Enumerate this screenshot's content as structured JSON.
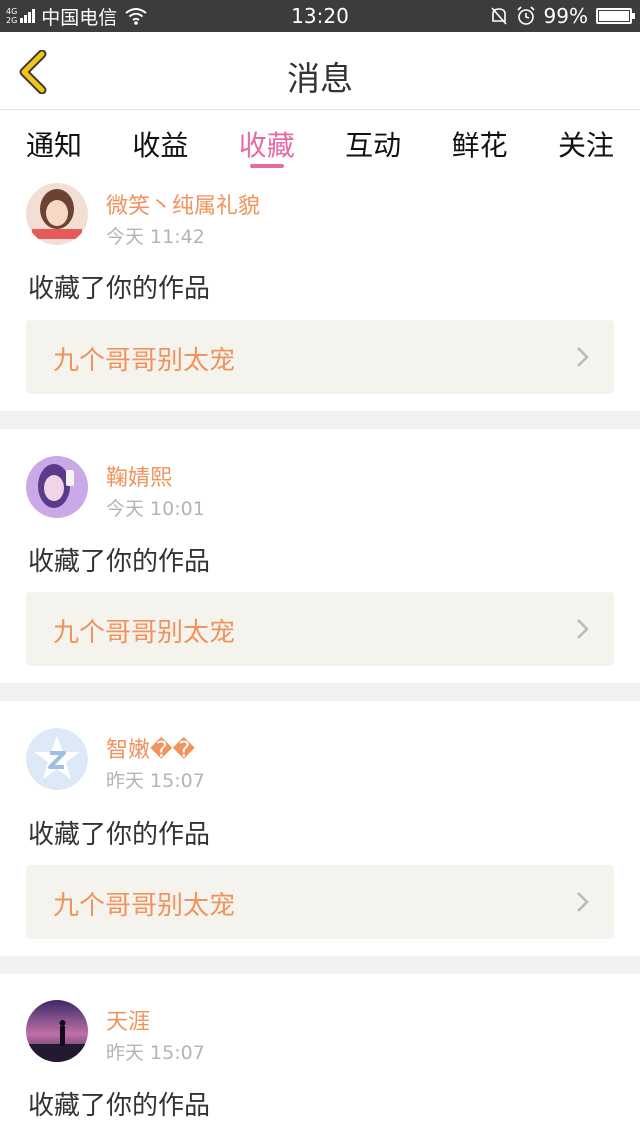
{
  "status_bar": {
    "network_top": "4G",
    "network_bottom": "2G",
    "carrier": "中国电信",
    "time": "13:20",
    "battery": "99%",
    "battery_level": 0.99
  },
  "header": {
    "title": "消息"
  },
  "tabs": [
    {
      "label": "通知",
      "active": false
    },
    {
      "label": "收益",
      "active": false
    },
    {
      "label": "收藏",
      "active": true
    },
    {
      "label": "互动",
      "active": false
    },
    {
      "label": "鲜花",
      "active": false
    },
    {
      "label": "关注",
      "active": false
    }
  ],
  "messages": [
    {
      "name": "微笑丶纯属礼貌",
      "time": "今天 11:42",
      "action": "收藏了你的作品",
      "work": "九个哥哥别太宠"
    },
    {
      "name": "鞠婧熙",
      "time": "今天 10:01",
      "action": "收藏了你的作品",
      "work": "九个哥哥别太宠"
    },
    {
      "name": "智嫩��",
      "time": "昨天 15:07",
      "action": "收藏了你的作品",
      "work": "九个哥哥别太宠"
    },
    {
      "name": "天涯",
      "time": "昨天 15:07",
      "action": "收藏了你的作品"
    }
  ],
  "colors": {
    "accent_pink": "#e76aa5",
    "name_orange": "#f0935c",
    "back_yellow": "#f2c419",
    "status_bar": "#3c3c3c"
  }
}
